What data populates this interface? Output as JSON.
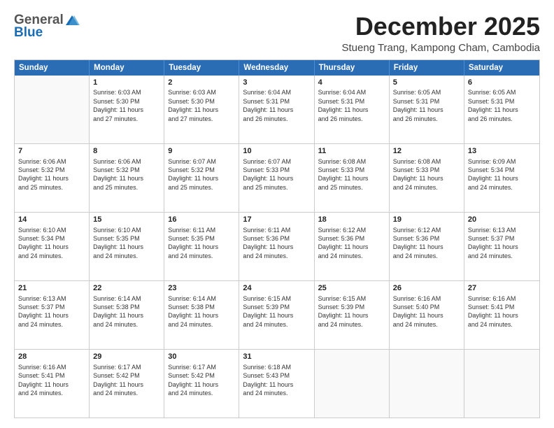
{
  "header": {
    "logo_general": "General",
    "logo_blue": "Blue",
    "month_title": "December 2025",
    "subtitle": "Stueng Trang, Kampong Cham, Cambodia"
  },
  "days_of_week": [
    "Sunday",
    "Monday",
    "Tuesday",
    "Wednesday",
    "Thursday",
    "Friday",
    "Saturday"
  ],
  "weeks": [
    [
      {
        "day": "",
        "data": ""
      },
      {
        "day": "1",
        "data": "Sunrise: 6:03 AM\nSunset: 5:30 PM\nDaylight: 11 hours\nand 27 minutes."
      },
      {
        "day": "2",
        "data": "Sunrise: 6:03 AM\nSunset: 5:30 PM\nDaylight: 11 hours\nand 27 minutes."
      },
      {
        "day": "3",
        "data": "Sunrise: 6:04 AM\nSunset: 5:31 PM\nDaylight: 11 hours\nand 26 minutes."
      },
      {
        "day": "4",
        "data": "Sunrise: 6:04 AM\nSunset: 5:31 PM\nDaylight: 11 hours\nand 26 minutes."
      },
      {
        "day": "5",
        "data": "Sunrise: 6:05 AM\nSunset: 5:31 PM\nDaylight: 11 hours\nand 26 minutes."
      },
      {
        "day": "6",
        "data": "Sunrise: 6:05 AM\nSunset: 5:31 PM\nDaylight: 11 hours\nand 26 minutes."
      }
    ],
    [
      {
        "day": "7",
        "data": "Sunrise: 6:06 AM\nSunset: 5:32 PM\nDaylight: 11 hours\nand 25 minutes."
      },
      {
        "day": "8",
        "data": "Sunrise: 6:06 AM\nSunset: 5:32 PM\nDaylight: 11 hours\nand 25 minutes."
      },
      {
        "day": "9",
        "data": "Sunrise: 6:07 AM\nSunset: 5:32 PM\nDaylight: 11 hours\nand 25 minutes."
      },
      {
        "day": "10",
        "data": "Sunrise: 6:07 AM\nSunset: 5:33 PM\nDaylight: 11 hours\nand 25 minutes."
      },
      {
        "day": "11",
        "data": "Sunrise: 6:08 AM\nSunset: 5:33 PM\nDaylight: 11 hours\nand 25 minutes."
      },
      {
        "day": "12",
        "data": "Sunrise: 6:08 AM\nSunset: 5:33 PM\nDaylight: 11 hours\nand 24 minutes."
      },
      {
        "day": "13",
        "data": "Sunrise: 6:09 AM\nSunset: 5:34 PM\nDaylight: 11 hours\nand 24 minutes."
      }
    ],
    [
      {
        "day": "14",
        "data": "Sunrise: 6:10 AM\nSunset: 5:34 PM\nDaylight: 11 hours\nand 24 minutes."
      },
      {
        "day": "15",
        "data": "Sunrise: 6:10 AM\nSunset: 5:35 PM\nDaylight: 11 hours\nand 24 minutes."
      },
      {
        "day": "16",
        "data": "Sunrise: 6:11 AM\nSunset: 5:35 PM\nDaylight: 11 hours\nand 24 minutes."
      },
      {
        "day": "17",
        "data": "Sunrise: 6:11 AM\nSunset: 5:36 PM\nDaylight: 11 hours\nand 24 minutes."
      },
      {
        "day": "18",
        "data": "Sunrise: 6:12 AM\nSunset: 5:36 PM\nDaylight: 11 hours\nand 24 minutes."
      },
      {
        "day": "19",
        "data": "Sunrise: 6:12 AM\nSunset: 5:36 PM\nDaylight: 11 hours\nand 24 minutes."
      },
      {
        "day": "20",
        "data": "Sunrise: 6:13 AM\nSunset: 5:37 PM\nDaylight: 11 hours\nand 24 minutes."
      }
    ],
    [
      {
        "day": "21",
        "data": "Sunrise: 6:13 AM\nSunset: 5:37 PM\nDaylight: 11 hours\nand 24 minutes."
      },
      {
        "day": "22",
        "data": "Sunrise: 6:14 AM\nSunset: 5:38 PM\nDaylight: 11 hours\nand 24 minutes."
      },
      {
        "day": "23",
        "data": "Sunrise: 6:14 AM\nSunset: 5:38 PM\nDaylight: 11 hours\nand 24 minutes."
      },
      {
        "day": "24",
        "data": "Sunrise: 6:15 AM\nSunset: 5:39 PM\nDaylight: 11 hours\nand 24 minutes."
      },
      {
        "day": "25",
        "data": "Sunrise: 6:15 AM\nSunset: 5:39 PM\nDaylight: 11 hours\nand 24 minutes."
      },
      {
        "day": "26",
        "data": "Sunrise: 6:16 AM\nSunset: 5:40 PM\nDaylight: 11 hours\nand 24 minutes."
      },
      {
        "day": "27",
        "data": "Sunrise: 6:16 AM\nSunset: 5:41 PM\nDaylight: 11 hours\nand 24 minutes."
      }
    ],
    [
      {
        "day": "28",
        "data": "Sunrise: 6:16 AM\nSunset: 5:41 PM\nDaylight: 11 hours\nand 24 minutes."
      },
      {
        "day": "29",
        "data": "Sunrise: 6:17 AM\nSunset: 5:42 PM\nDaylight: 11 hours\nand 24 minutes."
      },
      {
        "day": "30",
        "data": "Sunrise: 6:17 AM\nSunset: 5:42 PM\nDaylight: 11 hours\nand 24 minutes."
      },
      {
        "day": "31",
        "data": "Sunrise: 6:18 AM\nSunset: 5:43 PM\nDaylight: 11 hours\nand 24 minutes."
      },
      {
        "day": "",
        "data": ""
      },
      {
        "day": "",
        "data": ""
      },
      {
        "day": "",
        "data": ""
      }
    ]
  ]
}
